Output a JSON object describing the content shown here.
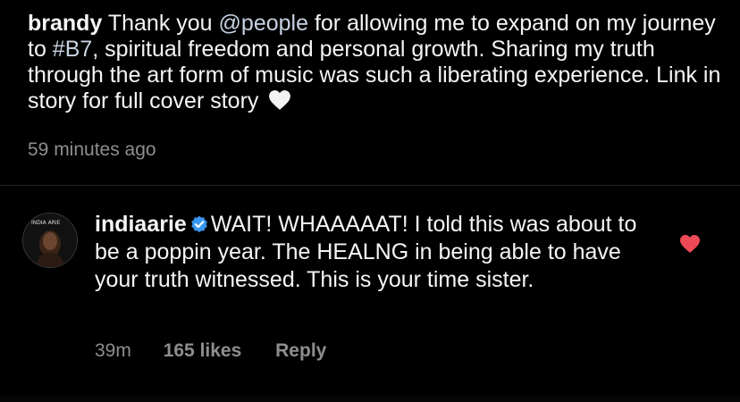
{
  "post": {
    "username": "brandy",
    "caption_parts": [
      {
        "text": " Thank you ",
        "type": "text"
      },
      {
        "text": "@people",
        "type": "mention"
      },
      {
        "text": " for allowing me to expand on my journey to ",
        "type": "text"
      },
      {
        "text": "#B7",
        "type": "hashtag"
      },
      {
        "text": ", spiritual freedom and personal growth. Sharing my truth through the art form of music was such a liberating experience. Link in story for full cover story ",
        "type": "text"
      }
    ],
    "emoji_icon": "white-heart-icon",
    "timestamp": "59 minutes ago"
  },
  "comment": {
    "username": "indiaarie",
    "verified_icon": "verified-badge-icon",
    "avatar_text": "INDIA ARIE",
    "text": "WAIT! WHAAAAAT! I told this was about to be a poppin year. The HEALNG in being able to have your truth witnessed.  This is your time sister.",
    "time": "39m",
    "likes": "165 likes",
    "reply_label": "Reply",
    "liked": true,
    "like_icon": "heart-icon"
  },
  "colors": {
    "background": "#000000",
    "text": "#f5f5f5",
    "muted": "#8e8e8e",
    "link": "#c7d2e2",
    "verified": "#3897f0",
    "like": "#ed4956",
    "divider": "#262626"
  }
}
